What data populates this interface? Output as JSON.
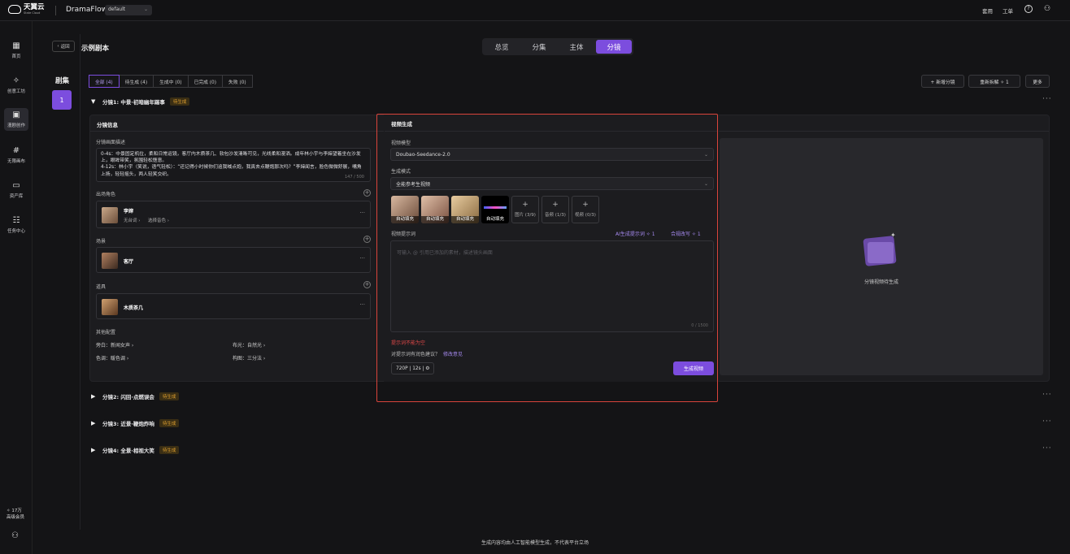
{
  "topbar": {
    "logo_cn": "天翼云",
    "logo_en": "State Cloud",
    "app_name": "DramaFlow",
    "project": "default",
    "pricing": "套用",
    "ticket": "工单",
    "help_icon": "help-circle-icon",
    "user_icon": "user-icon"
  },
  "sidebar": {
    "items": [
      {
        "label": "首页",
        "icon": "grid-icon"
      },
      {
        "label": "创意工坊",
        "icon": "sparkle-icon"
      },
      {
        "label": "漫剧创作",
        "icon": "film-icon"
      },
      {
        "label": "无限画布",
        "icon": "hash-icon"
      },
      {
        "label": "资产库",
        "icon": "folder-icon"
      },
      {
        "label": "任务中心",
        "icon": "tasks-icon"
      }
    ],
    "credits": "✧ 17万",
    "member": "高级会员",
    "team_icon": "team-icon"
  },
  "header": {
    "back": "返回",
    "title": "示例剧本",
    "tabs": [
      "总览",
      "分集",
      "主体",
      "分镜"
    ],
    "active_tab": "分镜"
  },
  "episodes": {
    "label": "剧集",
    "items": [
      "1"
    ]
  },
  "filters": [
    "全部 (4)",
    "待生成 (4)",
    "生成中 (0)",
    "已完成 (0)",
    "失败 (0)"
  ],
  "actions": {
    "add_shot": "+ 新增分镜",
    "resplit": "重新拆解 ✧ 1",
    "more": "更多"
  },
  "shots": [
    {
      "title": "分镜1: 中景·初暗幽年踢事",
      "status": "待生成",
      "expanded": true
    },
    {
      "title": "分镜2: 闪回·点燃误会",
      "status": "待生成"
    },
    {
      "title": "分镜3: 近景·鞭炮炸响",
      "status": "待生成"
    },
    {
      "title": "分镜4: 全景·相视大笑",
      "status": "待生成"
    }
  ],
  "shot_info": {
    "header": "分镜信息",
    "desc_label": "分镜画面描述",
    "desc_text": "0-4s：中景固定机位，柔和日常运镜，客厅内木质茶几、软包沙发清晰可见，光线柔和漫洒。成年林小宇与李婶望着坐在沙发上，眼眸带笑，氛围轻松惬意。\n4-12s：林小宇（笑说，语气轻松）：“还记得小时候你们追我喊点炮，我真去点鞭炮那次吗？”李婶闻言，脸色微微舒展，嘴角上扬，轻轻摇头，两人轻笑交织。",
    "desc_count": "147 / 500",
    "chars_label": "出场角色",
    "char_name": "李婶",
    "char_line": "无台词 ›",
    "char_voice": "选择音色 ›",
    "scene_label": "场景",
    "scene_name": "客厅",
    "props_label": "道具",
    "prop_name": "木质茶几",
    "other_label": "其他配置",
    "narration": "旁白：新闻女声 ›",
    "lighting": "布光：自然光 ›",
    "color": "色调：暖色调 ›",
    "composition": "构图：三分法 ›"
  },
  "video_gen": {
    "header": "视频生成",
    "model_label": "视频模型",
    "model": "Doubao-Seedance-2.0",
    "mode_label": "生成模式",
    "mode": "全能参考生视频",
    "refs": [
      "自动填充",
      "自动填充",
      "自动填充",
      "自动填充"
    ],
    "add_image": "图片 (3/9)",
    "add_audio": "音频 (1/3)",
    "add_video": "视频 (0/3)",
    "prompt_label": "视频提示词",
    "ai_prompt": "AI生成提示词 ✧ 1",
    "merge_rewrite": "合规改写 ✧ 1",
    "prompt_placeholder": "可输入 @ 引用已添加的素材，描述镜头画面",
    "prompt_count": "0 / 1500",
    "error": "提示词不能为空",
    "feedback_q": "对提示词有润色建议？",
    "feedback_link": "修改意见",
    "spec": "720P | 12s | ⚙",
    "generate": "生成视频",
    "preview_text": "分镜视频待生成"
  },
  "footer": "生成内容均由人工智能模型生成，不代表平台立场"
}
